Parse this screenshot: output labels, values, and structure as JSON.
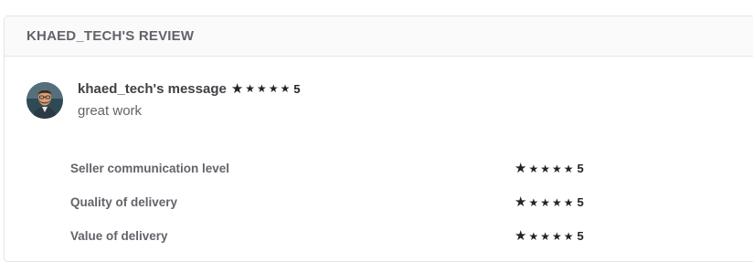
{
  "review": {
    "title": "KHAED_TECH'S REVIEW",
    "reviewer_message_label": "khaed_tech's message",
    "overall_rating": "5",
    "message": "great work"
  },
  "ratings": [
    {
      "label": "Seller communication level",
      "value": "5"
    },
    {
      "label": "Quality of delivery",
      "value": "5"
    },
    {
      "label": "Value of delivery",
      "value": "5"
    }
  ],
  "icons": {
    "star": "star-icon",
    "avatar": "reviewer-avatar"
  },
  "colors": {
    "star": "#222325",
    "header_bg": "#fafafa",
    "border": "#e4e5e7"
  }
}
